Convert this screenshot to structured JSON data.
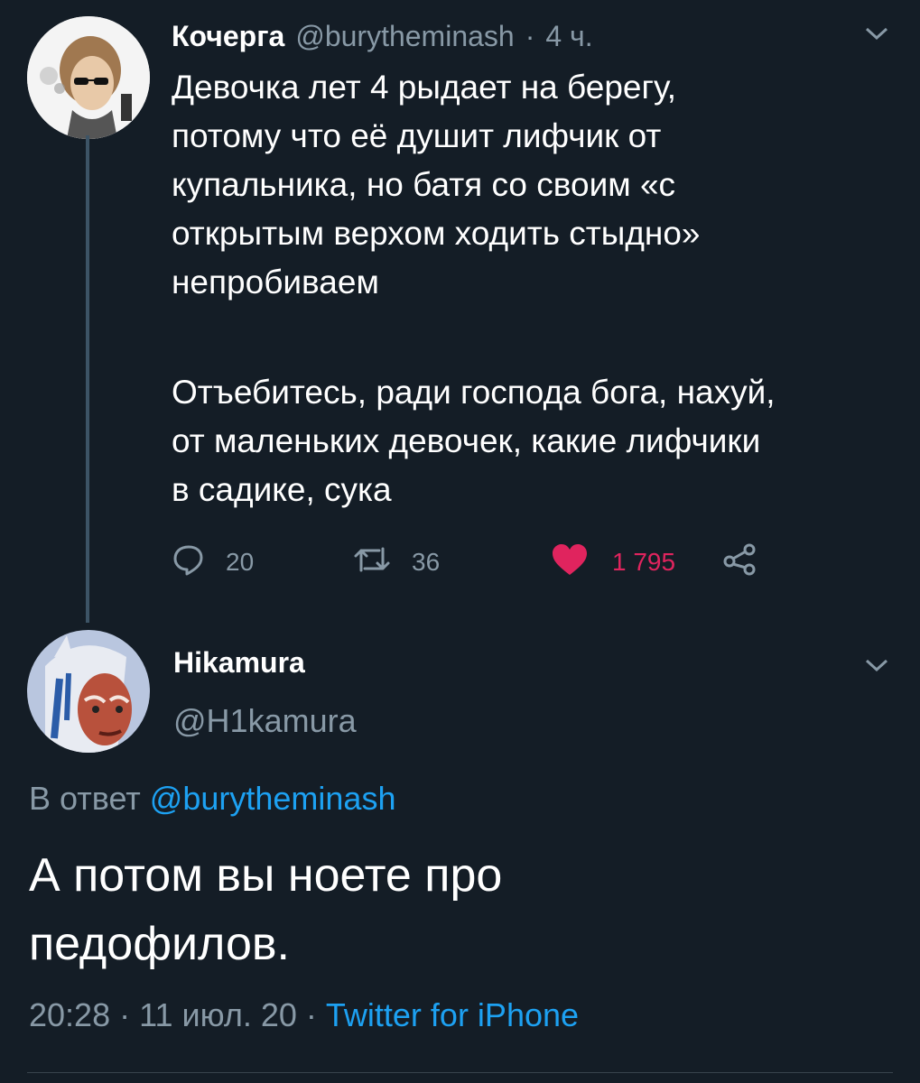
{
  "tweet1": {
    "name": "Кочерга",
    "handle": "@burytheminash",
    "time": "4 ч.",
    "dot": "·",
    "body_p1": "Девочка лет 4 рыдает на берегу,\nпотому что её душит лифчик от\nкупальника, но батя со своим «с\nоткрытым верхом ходить стыдно»\nнепробиваем",
    "body_p2": "Отъебитесь, ради господа бога, нахуй,\nот маленьких девочек, какие лифчики\nв садике, сука",
    "replies": "20",
    "retweets": "36",
    "likes": "1 795",
    "colors": {
      "like": "#e0245e",
      "muted": "#8899a6"
    }
  },
  "tweet2": {
    "name": "Hikamura",
    "handle": "@H1kamura",
    "reply_prefix": "В ответ",
    "reply_mention": "@burytheminash",
    "body": "А потом вы ноете про педофилов.",
    "time": "20:28",
    "date": "11 июл. 20",
    "sep": "·",
    "source": "Twitter for iPhone",
    "colors": {
      "link": "#1da1f2"
    }
  },
  "icons": [
    "chevron-down-icon",
    "reply-icon",
    "retweet-icon",
    "heart-icon",
    "share-icon"
  ],
  "colors": {
    "background": "#141d26",
    "thread_line": "#3d5466"
  }
}
